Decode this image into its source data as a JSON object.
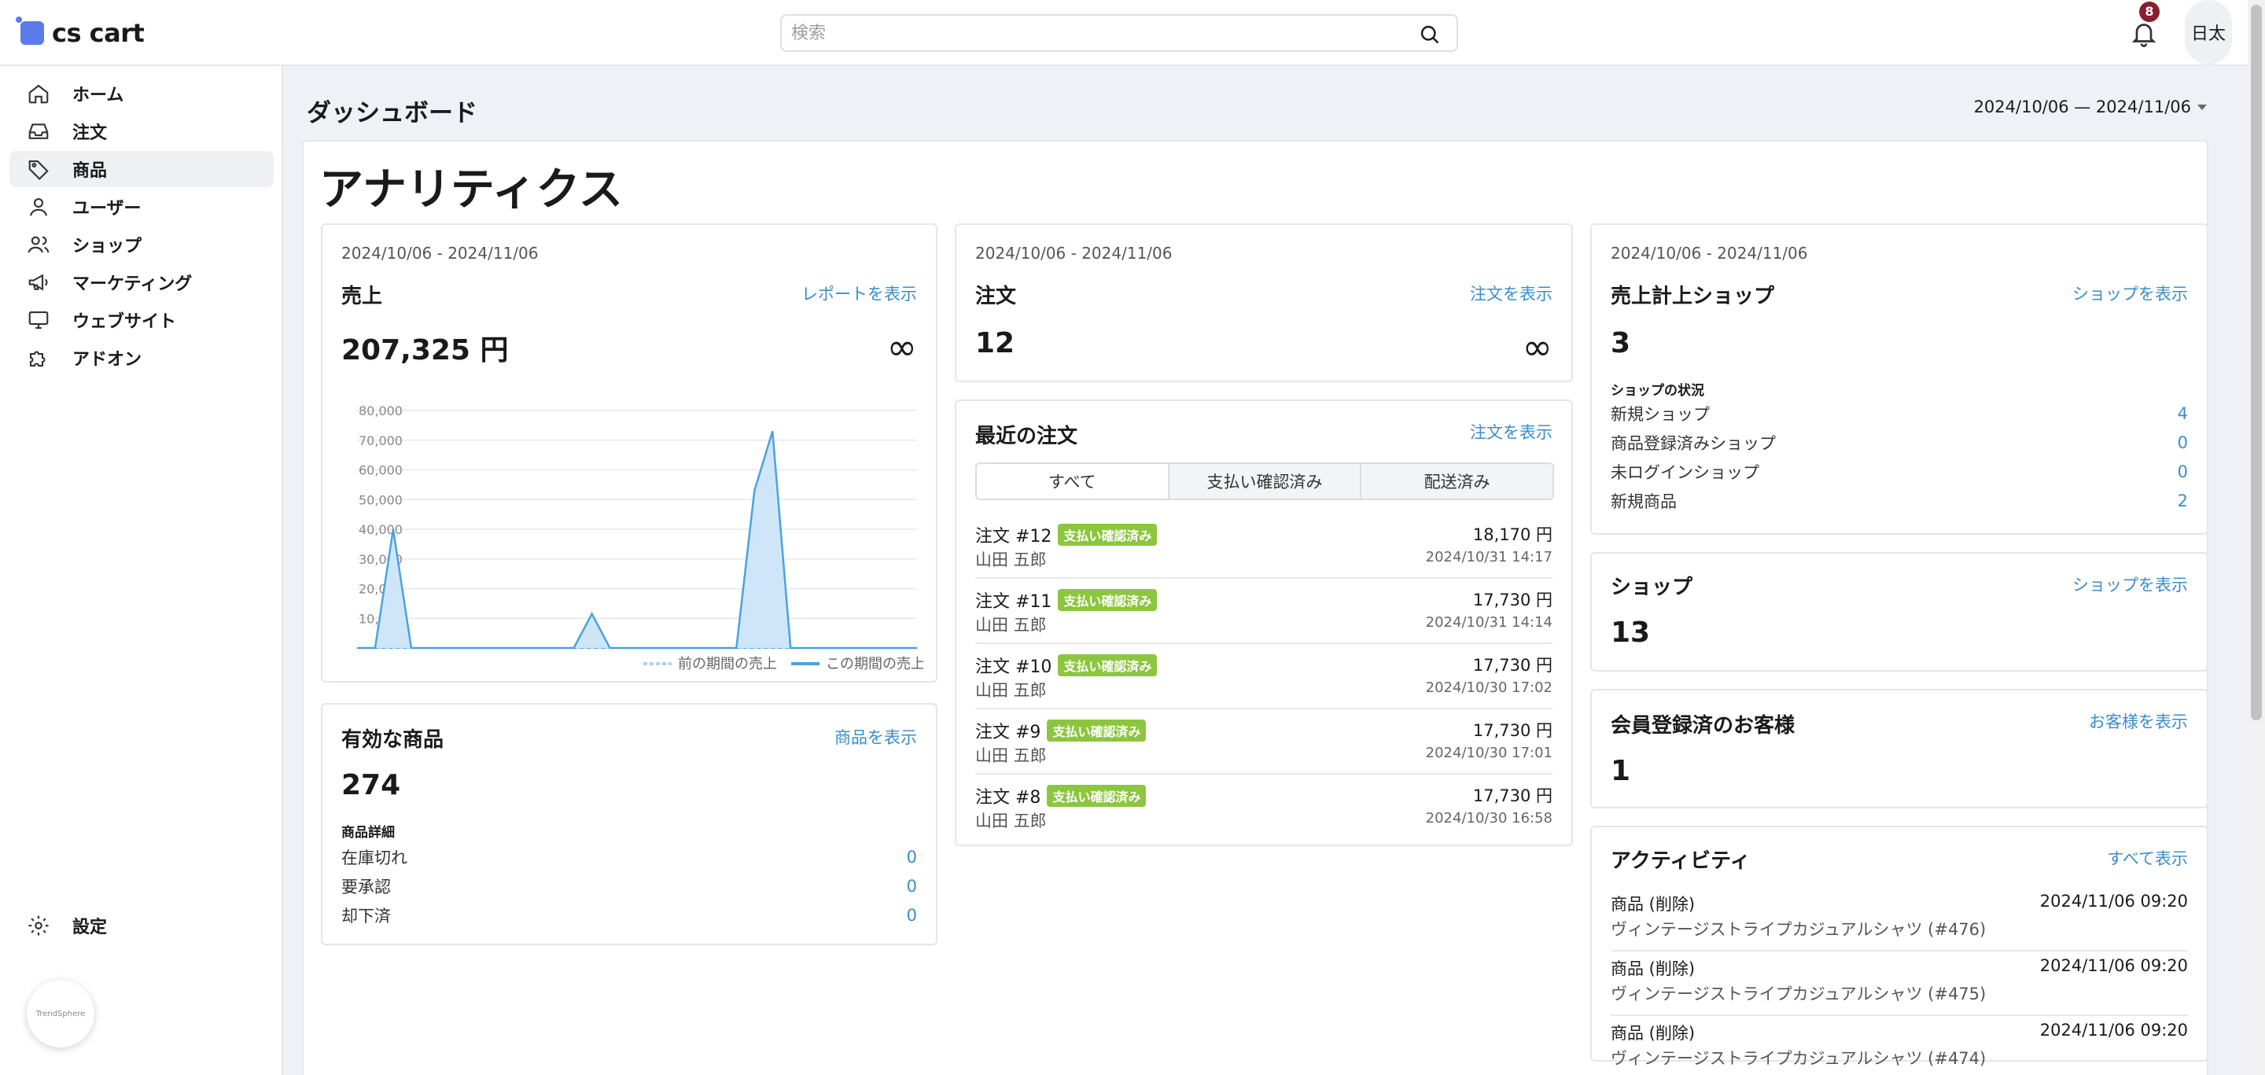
{
  "app": {
    "logo_text": "cs cart"
  },
  "header": {
    "search_placeholder": "検索",
    "notification_count": "8",
    "user_label": "日太"
  },
  "sidebar": {
    "items": [
      {
        "label": "ホーム",
        "icon": "home-icon"
      },
      {
        "label": "注文",
        "icon": "inbox-icon"
      },
      {
        "label": "商品",
        "icon": "tag-icon"
      },
      {
        "label": "ユーザー",
        "icon": "user-icon"
      },
      {
        "label": "ショップ",
        "icon": "users-icon"
      },
      {
        "label": "マーケティング",
        "icon": "megaphone-icon"
      },
      {
        "label": "ウェブサイト",
        "icon": "monitor-icon"
      },
      {
        "label": "アドオン",
        "icon": "puzzle-icon"
      }
    ],
    "active_index": 2,
    "settings_label": "設定",
    "badge_text": "TrendSphere"
  },
  "page": {
    "title": "ダッシュボード",
    "date_range": "2024/10/06 — 2024/11/06",
    "analytics_title": "アナリティクス"
  },
  "sales": {
    "date": "2024/10/06 - 2024/11/06",
    "title": "売上",
    "link": "レポートを表示",
    "value": "207,325 円",
    "change": "∞"
  },
  "orders_summary": {
    "date": "2024/10/06 - 2024/11/06",
    "title": "注文",
    "link": "注文を表示",
    "value": "12",
    "change": "∞"
  },
  "shops_sales": {
    "date": "2024/10/06 - 2024/11/06",
    "title": "売上計上ショップ",
    "link": "ショップを表示",
    "value": "3",
    "status_heading": "ショップの状況",
    "stats": [
      {
        "label": "新規ショップ",
        "value": "4"
      },
      {
        "label": "商品登録済みショップ",
        "value": "0"
      },
      {
        "label": "未ログインショップ",
        "value": "0"
      },
      {
        "label": "新規商品",
        "value": "2"
      }
    ]
  },
  "shops": {
    "title": "ショップ",
    "link": "ショップを表示",
    "value": "13"
  },
  "customers": {
    "title": "会員登録済のお客様",
    "link": "お客様を表示",
    "value": "1"
  },
  "products": {
    "title": "有効な商品",
    "link": "商品を表示",
    "value": "274",
    "detail_heading": "商品詳細",
    "stats": [
      {
        "label": "在庫切れ",
        "value": "0"
      },
      {
        "label": "要承認",
        "value": "0"
      },
      {
        "label": "却下済",
        "value": "0"
      }
    ]
  },
  "recent_orders": {
    "title": "最近の注文",
    "link": "注文を表示",
    "tabs": [
      "すべて",
      "支払い確認済み",
      "配送済み"
    ],
    "active_tab": 0,
    "rows": [
      {
        "id": "注文 #12",
        "status": "支払い確認済み",
        "name": "山田 五郎",
        "amount": "18,170 円",
        "time": "2024/10/31 14:17"
      },
      {
        "id": "注文 #11",
        "status": "支払い確認済み",
        "name": "山田 五郎",
        "amount": "17,730 円",
        "time": "2024/10/31 14:14"
      },
      {
        "id": "注文 #10",
        "status": "支払い確認済み",
        "name": "山田 五郎",
        "amount": "17,730 円",
        "time": "2024/10/30 17:02"
      },
      {
        "id": "注文 #9",
        "status": "支払い確認済み",
        "name": "山田 五郎",
        "amount": "17,730 円",
        "time": "2024/10/30 17:01"
      },
      {
        "id": "注文 #8",
        "status": "支払い確認済み",
        "name": "山田 五郎",
        "amount": "17,730 円",
        "time": "2024/10/30 16:58"
      }
    ]
  },
  "activity": {
    "title": "アクティビティ",
    "link": "すべて表示",
    "rows": [
      {
        "type": "商品 (削除)",
        "desc": "ヴィンテージストライプカジュアルシャツ (#476)",
        "time": "2024/11/06 09:20"
      },
      {
        "type": "商品 (削除)",
        "desc": "ヴィンテージストライプカジュアルシャツ (#475)",
        "time": "2024/11/06 09:20"
      },
      {
        "type": "商品 (削除)",
        "desc": "ヴィンテージストライプカジュアルシャツ (#474)",
        "time": "2024/11/06 09:20"
      }
    ]
  },
  "chart_data": {
    "type": "area",
    "ylim": [
      0,
      80000
    ],
    "yticks": [
      "10,000",
      "20,000",
      "30,000",
      "40,000",
      "50,000",
      "60,000",
      "70,000",
      "80,000"
    ],
    "x": [
      1,
      2,
      3,
      4,
      5,
      6,
      7,
      8,
      9,
      10,
      11,
      12,
      13,
      14,
      15,
      16,
      17,
      18,
      19,
      20,
      21,
      22,
      23,
      24,
      25,
      26,
      27,
      28,
      29,
      30,
      31,
      32
    ],
    "series": [
      {
        "name": "前の期間の売上",
        "values": [
          0,
          0,
          0,
          0,
          0,
          0,
          0,
          0,
          0,
          0,
          0,
          0,
          0,
          0,
          0,
          0,
          0,
          0,
          0,
          0,
          0,
          0,
          0,
          0,
          0,
          0,
          0,
          0,
          0,
          0,
          0,
          0
        ]
      },
      {
        "name": "この期間の売上",
        "values": [
          0,
          0,
          40000,
          0,
          0,
          0,
          0,
          0,
          0,
          0,
          0,
          0,
          0,
          11500,
          0,
          0,
          0,
          0,
          0,
          0,
          0,
          0,
          53000,
          73000,
          0,
          0,
          0,
          0,
          0,
          0,
          0,
          0
        ]
      }
    ],
    "colors": {
      "current": "#4aa3de",
      "current_fill": "#cfe6f8",
      "previous": "#a9d3f0"
    }
  }
}
